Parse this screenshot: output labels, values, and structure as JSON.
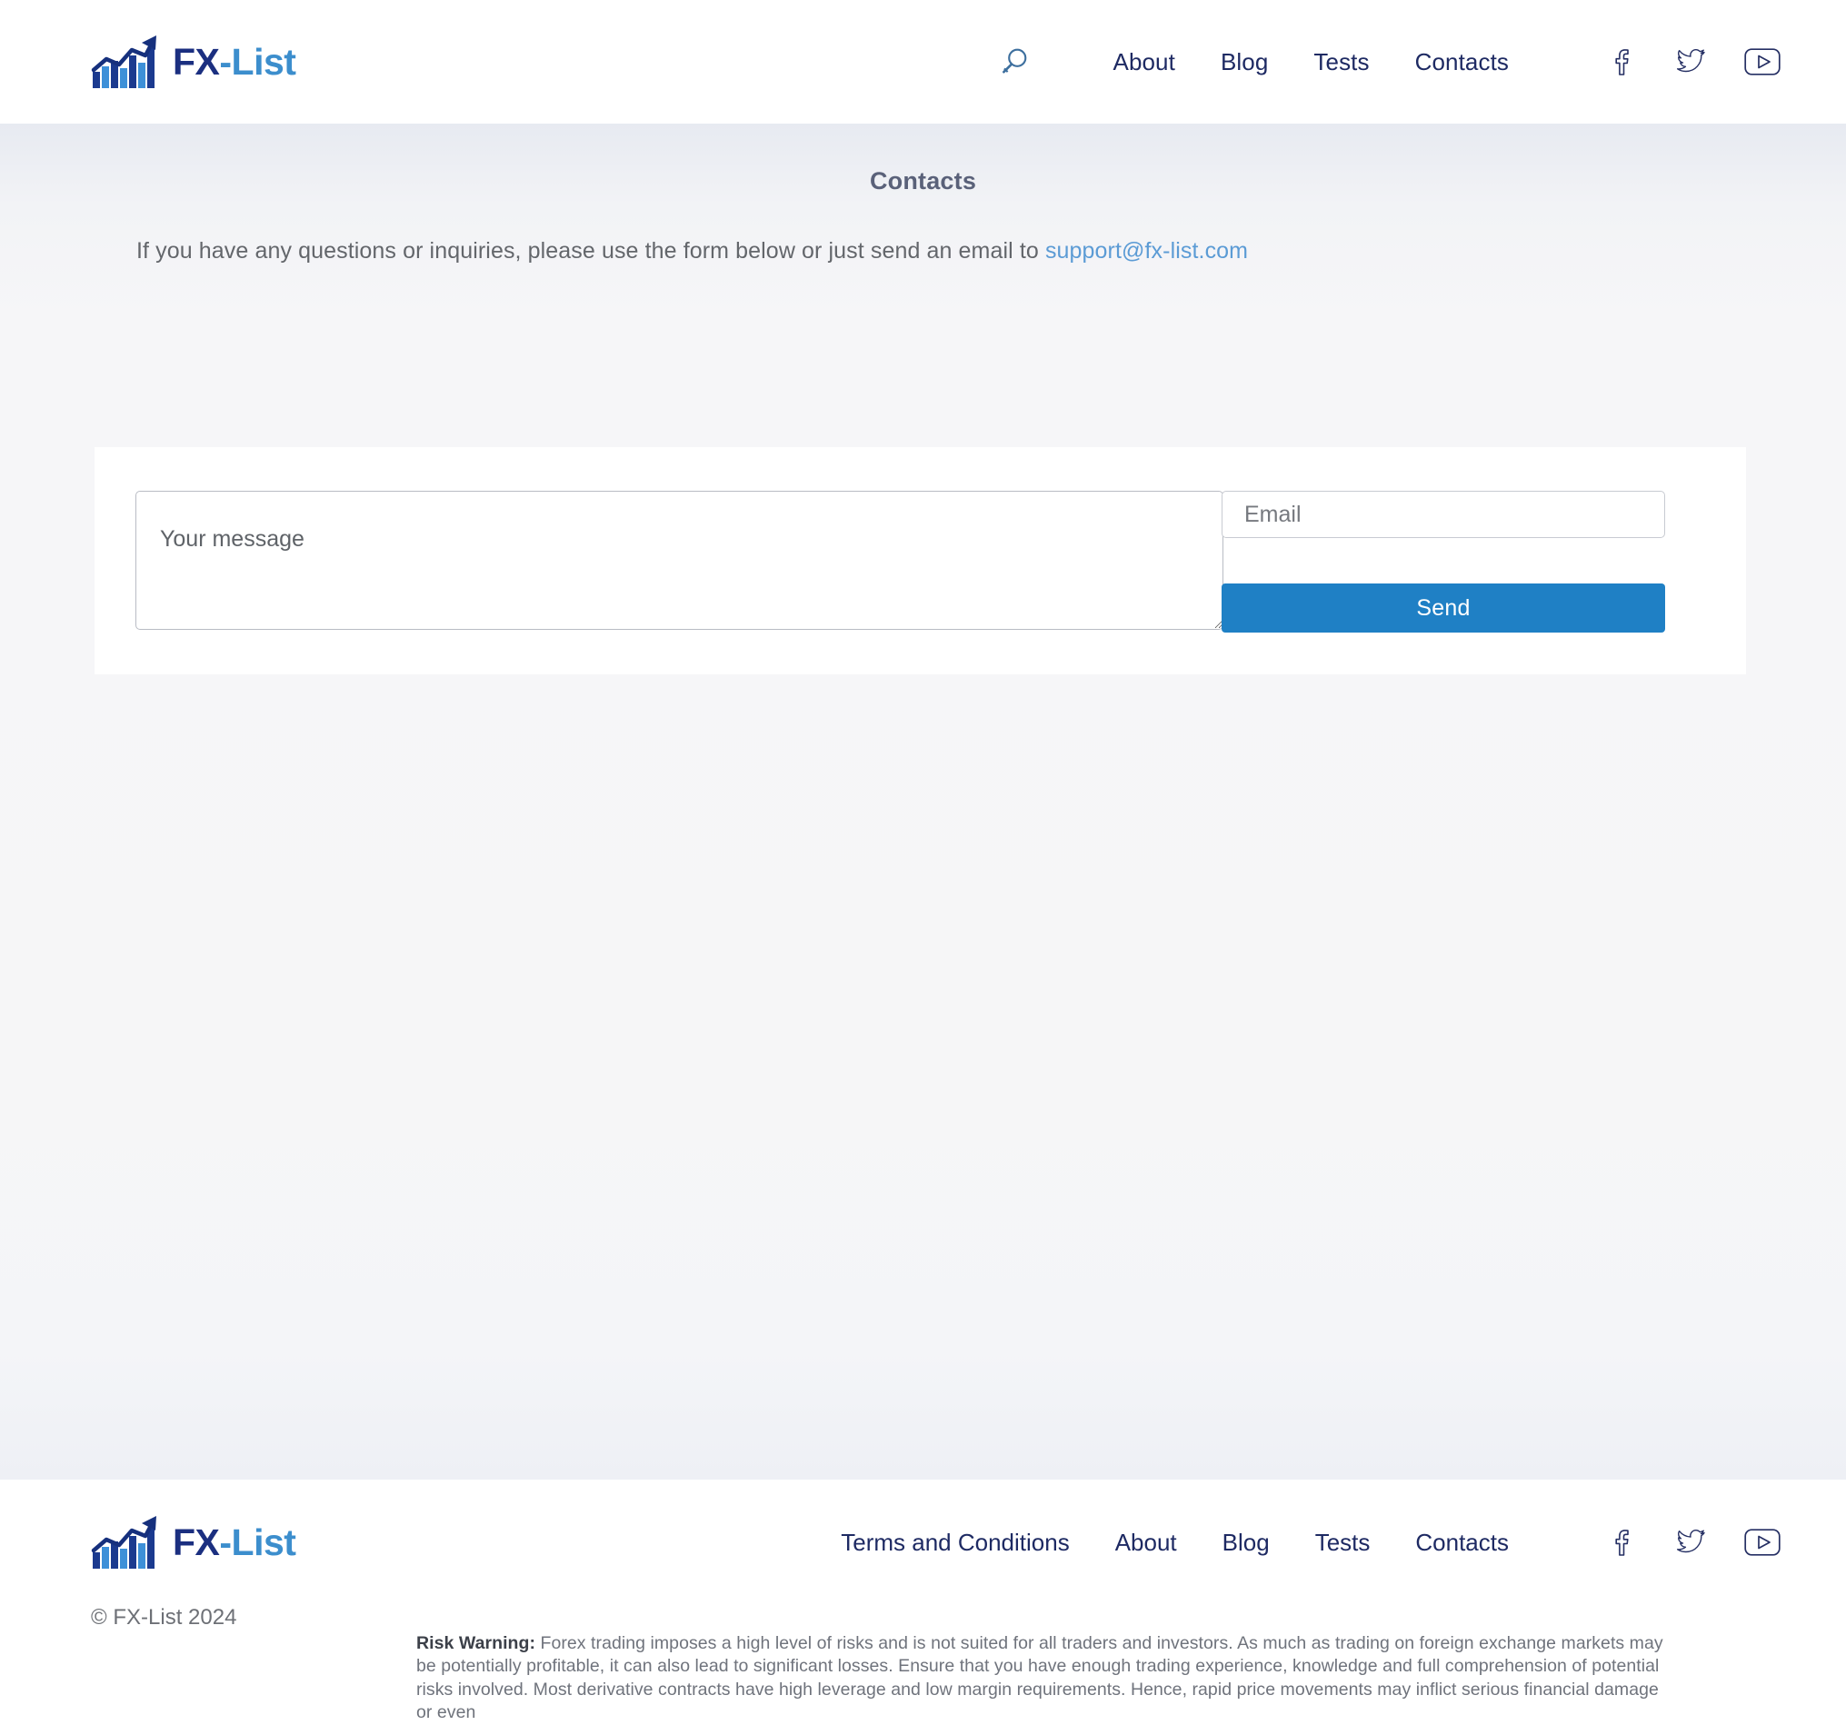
{
  "brand": {
    "name_primary": "FX",
    "name_secondary": "-List",
    "logo_icon": "bar-chart-uptrend-arrow-icon"
  },
  "header": {
    "search_icon": "search-icon",
    "nav": [
      {
        "label": "About"
      },
      {
        "label": "Blog"
      },
      {
        "label": "Tests"
      },
      {
        "label": "Contacts"
      }
    ],
    "social": [
      {
        "name": "facebook-icon"
      },
      {
        "name": "twitter-icon"
      },
      {
        "name": "youtube-icon"
      }
    ]
  },
  "main": {
    "page_title": "Contacts",
    "intro_prefix": "If you have any questions or inquiries, please use the form below or just send an email to ",
    "support_email": "support@fx-list.com",
    "form": {
      "message_placeholder": "Your message",
      "message_value": "",
      "email_placeholder": "Email",
      "email_value": "",
      "send_label": "Send",
      "send_color": "#1f80c5"
    }
  },
  "footer": {
    "nav": [
      {
        "label": "Terms and Conditions"
      },
      {
        "label": "About"
      },
      {
        "label": "Blog"
      },
      {
        "label": "Tests"
      },
      {
        "label": "Contacts"
      }
    ],
    "social": [
      {
        "name": "facebook-icon"
      },
      {
        "name": "twitter-icon"
      },
      {
        "name": "youtube-icon"
      }
    ],
    "copyright": "© FX-List 2024",
    "risk_warning_label": "Risk Warning:",
    "risk_warning_text": " Forex trading imposes a high level of risks and is not suited for all traders and investors. As much as trading on foreign exchange markets may be potentially profitable, it can also lead to significant losses. Ensure that you have enough trading experience, knowledge and full comprehension of potential risks involved. Most derivative contracts have high leverage and low margin requirements. Hence, rapid price movements may inflict serious financial damage or even"
  },
  "colors": {
    "navy": "#1e2a63",
    "link_blue": "#5b9bd5",
    "accent_blue": "#1f80c5",
    "logo_light": "#3c8ecd",
    "heading": "#5a6179"
  }
}
